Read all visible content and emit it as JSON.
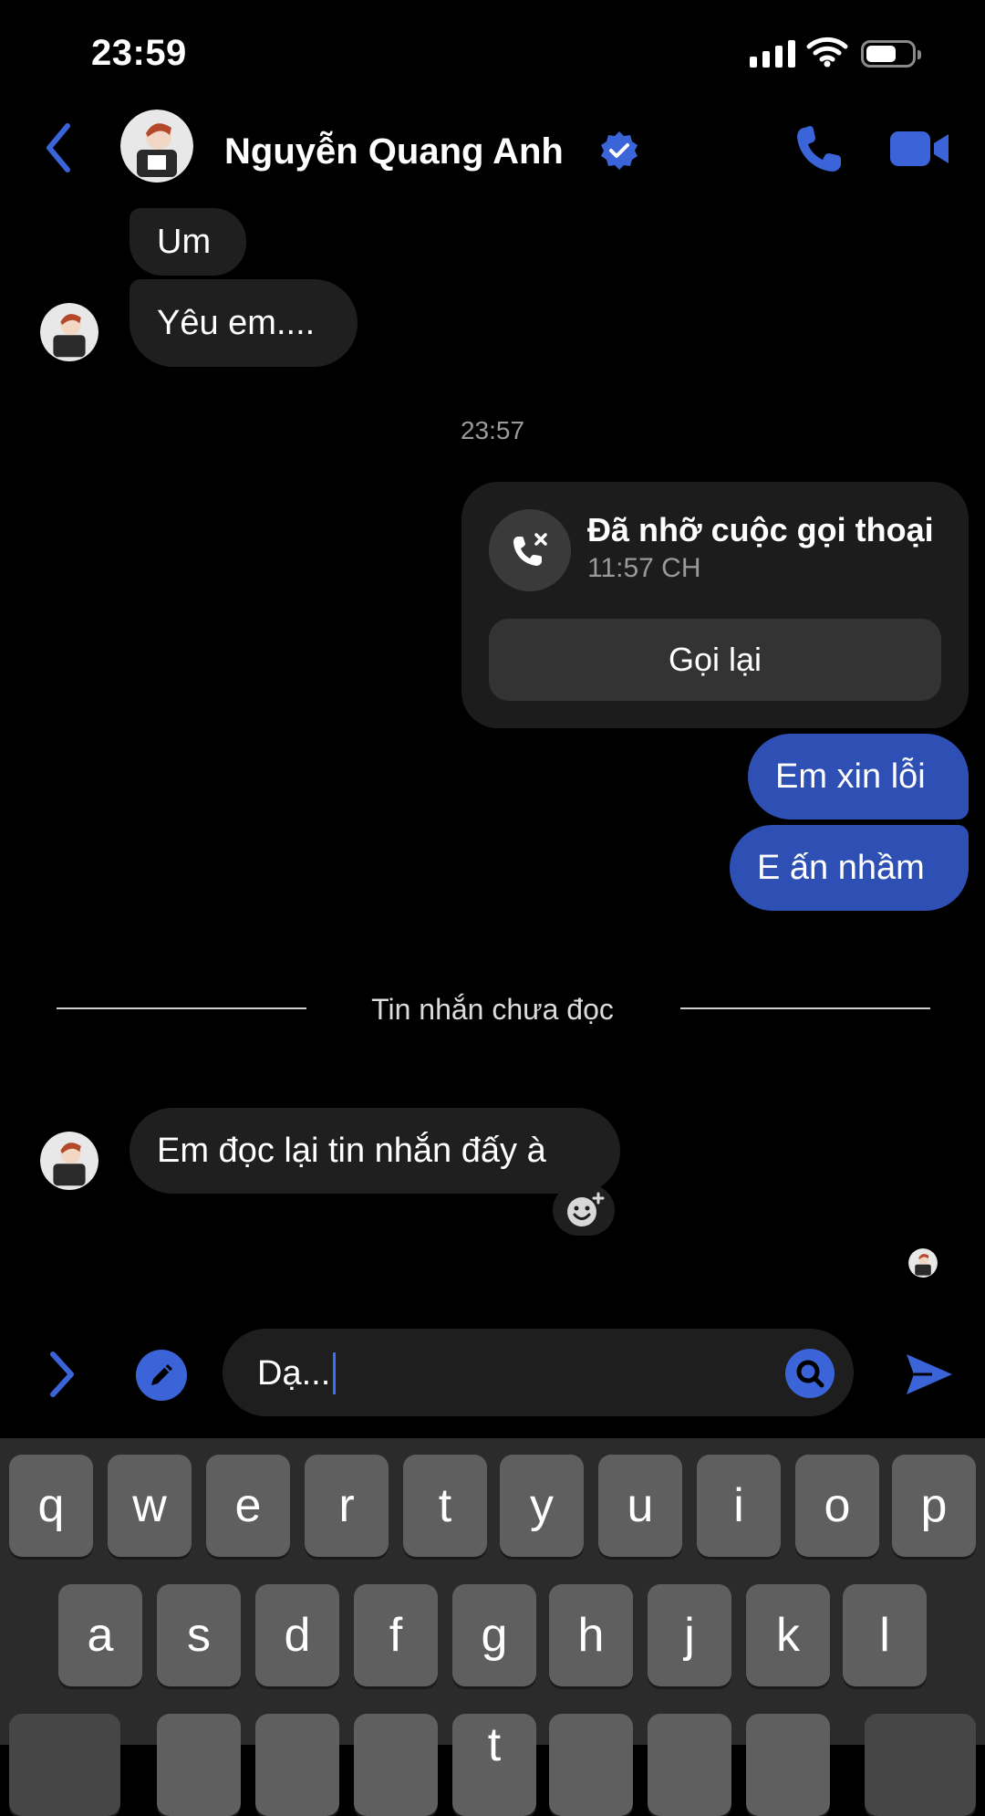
{
  "status_bar": {
    "time": "23:59"
  },
  "header": {
    "contact_name": "Nguyễn Quang Anh"
  },
  "messages": {
    "incoming_1": "Um",
    "incoming_2": "Yêu em....",
    "timestamp": "23:57",
    "missed_call_title": "Đã nhỡ cuộc gọi thoại",
    "missed_call_time": "11:57 CH",
    "callback_label": "Gọi lại",
    "outgoing_1": "Em xin lỗi",
    "outgoing_2": "E ấn nhầm",
    "unread_divider": "Tin nhắn chưa đọc",
    "incoming_3": "Em đọc lại tin nhắn đấy à"
  },
  "composer": {
    "value": "Dạ..."
  },
  "keyboard": {
    "row1": [
      "q",
      "w",
      "e",
      "r",
      "t",
      "y",
      "u",
      "i",
      "o",
      "p"
    ],
    "row2": [
      "a",
      "s",
      "d",
      "f",
      "g",
      "h",
      "j",
      "k",
      "l"
    ],
    "row3_partial": [
      "t"
    ]
  },
  "colors": {
    "accent": "#2e4fb3",
    "background": "#000000",
    "incoming_bubble": "#1f1f1f",
    "keyboard_bg": "#2b2b2b",
    "key_bg": "#5f5f5f"
  }
}
